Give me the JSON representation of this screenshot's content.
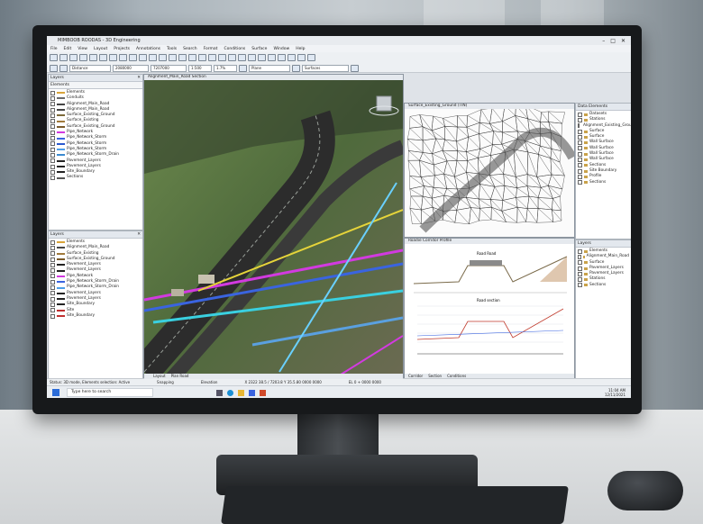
{
  "app": {
    "title": "MIMBOOB ROODAS - 3D Engineering",
    "menus": [
      "File",
      "Edit",
      "View",
      "Layout",
      "Projects",
      "Annotations",
      "Tools",
      "Search",
      "Format",
      "Conditions",
      "Surface",
      "Window",
      "Help"
    ],
    "fields": {
      "snap": "Distance",
      "x": "2080000",
      "y": "7207000",
      "scale": "1:500",
      "zoom": "1.7%",
      "plane": "Plane",
      "surface": "Surfaces"
    }
  },
  "elements_panel": {
    "header": "Layers",
    "title": "Elements",
    "items": [
      {
        "label": "Elements",
        "color": "#d9a53a"
      },
      {
        "label": "Conduits",
        "color": "#6a6a6a"
      },
      {
        "label": "Alignment_Main_Road",
        "color": "#444444"
      },
      {
        "label": "Alignment_Main_Road",
        "color": "#444444"
      },
      {
        "label": "Surface_Existing_Ground",
        "color": "#7c6a3a"
      },
      {
        "label": "Surface_Existing",
        "color": "#a07a3c"
      },
      {
        "label": "Surface_Existing_Ground",
        "color": "#7a5a2a"
      },
      {
        "label": "Pipe_Network",
        "color": "#d23ae0"
      },
      {
        "label": "Pipe_Network_Storm",
        "color": "#3a64e0"
      },
      {
        "label": "Pipe_Network_Storm",
        "color": "#2b5ad0"
      },
      {
        "label": "Pipe_Network_Storm",
        "color": "#4d9ee8"
      },
      {
        "label": "Pipe_Network_Storm_Drain",
        "color": "#3a8ad0"
      },
      {
        "label": "Pavement_Layers",
        "color": "#222222"
      },
      {
        "label": "Pavement_Layers",
        "color": "#222222"
      },
      {
        "label": "Site_Boundary",
        "color": "#222222"
      },
      {
        "label": "Sections",
        "color": "#555555"
      }
    ]
  },
  "layers_panel": {
    "header": "Layers",
    "items": [
      {
        "label": "Elements",
        "color": "#d9a53a"
      },
      {
        "label": "Alignment_Main_Road",
        "color": "#444444"
      },
      {
        "label": "Surface_Existing",
        "color": "#a07a3c"
      },
      {
        "label": "Surface_Existing_Ground",
        "color": "#7a5a2a"
      },
      {
        "label": "Pavement_Layers",
        "color": "#222222"
      },
      {
        "label": "Pavement_Layers",
        "color": "#222222"
      },
      {
        "label": "Pipe_Network",
        "color": "#d23ae0"
      },
      {
        "label": "Pipe_Network_Storm_Drain",
        "color": "#3a64e0"
      },
      {
        "label": "Pipe_Network_Storm_Drain",
        "color": "#4d9ee8"
      },
      {
        "label": "Pavement_Layers",
        "color": "#222222"
      },
      {
        "label": "Pavement_Layers",
        "color": "#222222"
      },
      {
        "label": "Site_Boundary",
        "color": "#222222"
      },
      {
        "label": "Site",
        "color": "#c03030"
      },
      {
        "label": "Site_Boundary",
        "color": "#c03030"
      }
    ]
  },
  "views": {
    "main3d": {
      "title": "Alignment_Main_Road Section",
      "tabs": [
        "Layout",
        "Plan Road"
      ]
    },
    "wireframe": {
      "title": "Surface_Existing_Ground (TIN)"
    },
    "profile": {
      "title": "Roadie Corridor Profile",
      "tabs": [
        "Corridor",
        "Section",
        "Conditions"
      ],
      "label_road": "Road Road",
      "label_section": "Road section"
    }
  },
  "data_panel": {
    "header": "Data Elements",
    "items": [
      "Datasets",
      "Stations",
      "Alignment_Existing_Ground",
      "Surface",
      "Surface",
      "Wall Surface",
      "Wall Surface",
      "Wall Surface",
      "Wall Surface",
      "Sections",
      "Site Boundary",
      "Profile",
      "Sections"
    ]
  },
  "layers_right": {
    "header": "Layers",
    "items": [
      "Elements",
      "Alignment_Main_Road",
      "Surface",
      "Pavement_Layers",
      "Pavement_Layers",
      "Stations",
      "Sections"
    ]
  },
  "status": {
    "left": "Status: 3D mode, Elements selection: Active",
    "mid1": "Snapping",
    "mid2": "Elevation",
    "coords": "X 2322 38.5 / 7203.8 Y 35.5.80 0000 0000",
    "right": "EL 0 + 0000 0000"
  },
  "taskbar": {
    "search_placeholder": "Type here to search",
    "time": "11:04 AM",
    "date": "12/11/2021"
  },
  "colors": {
    "terrain": "#4e6a3a",
    "road": "#3a3a3a",
    "pipe_magenta": "#d23ae0",
    "pipe_blue": "#3a64e0",
    "pipe_cyan": "#3ad0e0",
    "pipe_yellow": "#e6d43a"
  }
}
